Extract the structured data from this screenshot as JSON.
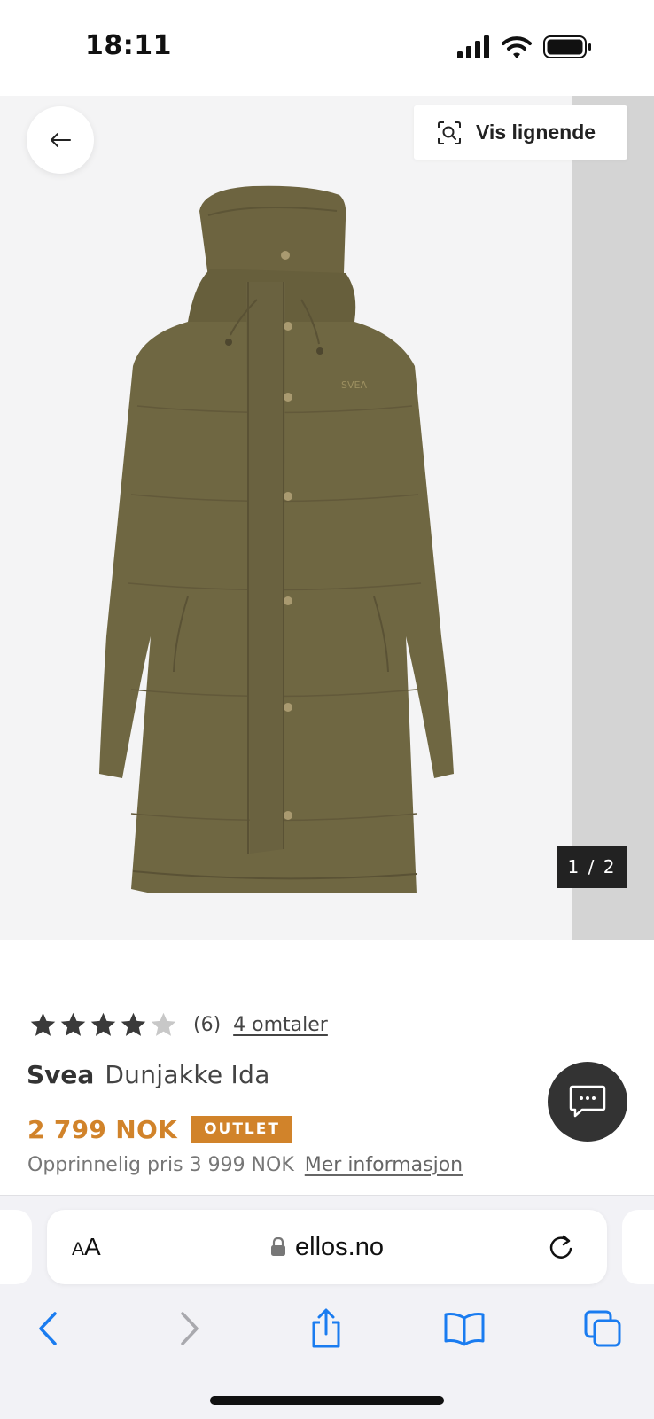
{
  "status_bar": {
    "time": "18:11",
    "icons": [
      "cellular-signal-icon",
      "wifi-icon",
      "battery-icon"
    ]
  },
  "gallery": {
    "back_icon": "arrow-left-icon",
    "similar_button": {
      "label": "Vis lignende",
      "icon": "visual-search-icon"
    },
    "counter": "1 / 2",
    "brand_print": "SVEA"
  },
  "product": {
    "rating": {
      "stars": 4,
      "max": 5,
      "count": "(6)",
      "reviews_link": "4 omtaler"
    },
    "brand": "Svea",
    "name": "Dunjakke Ida",
    "price": "2 799 NOK",
    "badge": "OUTLET",
    "original_price": "Opprinnelig pris 3 999 NOK",
    "more_info": "Mer informasjon"
  },
  "chat_button": {
    "icon": "chat-bubble-icon"
  },
  "browser": {
    "aa_small": "A",
    "aa_large": "A",
    "url": "ellos.no",
    "nav": [
      "back-icon",
      "forward-icon",
      "share-icon",
      "bookmarks-icon",
      "tabs-icon"
    ]
  },
  "colors": {
    "accent": "#d1832a",
    "ios_blue": "#1a7cf0",
    "jacket": "#6e6540"
  }
}
